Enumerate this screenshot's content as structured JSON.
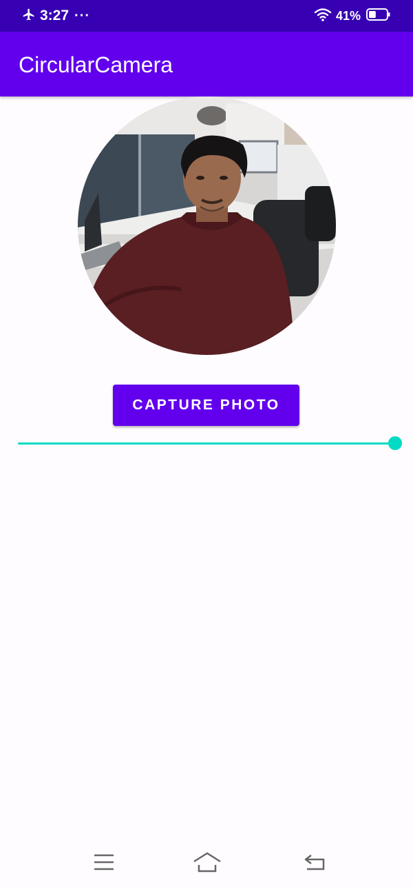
{
  "status_bar": {
    "time": "3:27",
    "dots": "···",
    "battery_percent": "41%",
    "battery_level": 0.41,
    "icons": [
      "airplane-mode-icon",
      "wifi-icon",
      "battery-icon"
    ]
  },
  "app_bar": {
    "title": "CircularCamera"
  },
  "camera": {
    "shape": "circle"
  },
  "capture_button": {
    "label": "CAPTURE PHOTO"
  },
  "slider": {
    "value": 1.0,
    "color": "#03dac5"
  },
  "nav_bar": {
    "icons": [
      "menu-icon",
      "home-icon",
      "back-icon"
    ]
  },
  "colors": {
    "status_bar": "#3700b3",
    "primary": "#6200ee",
    "accent": "#03dac5",
    "background": "#fefcff"
  }
}
